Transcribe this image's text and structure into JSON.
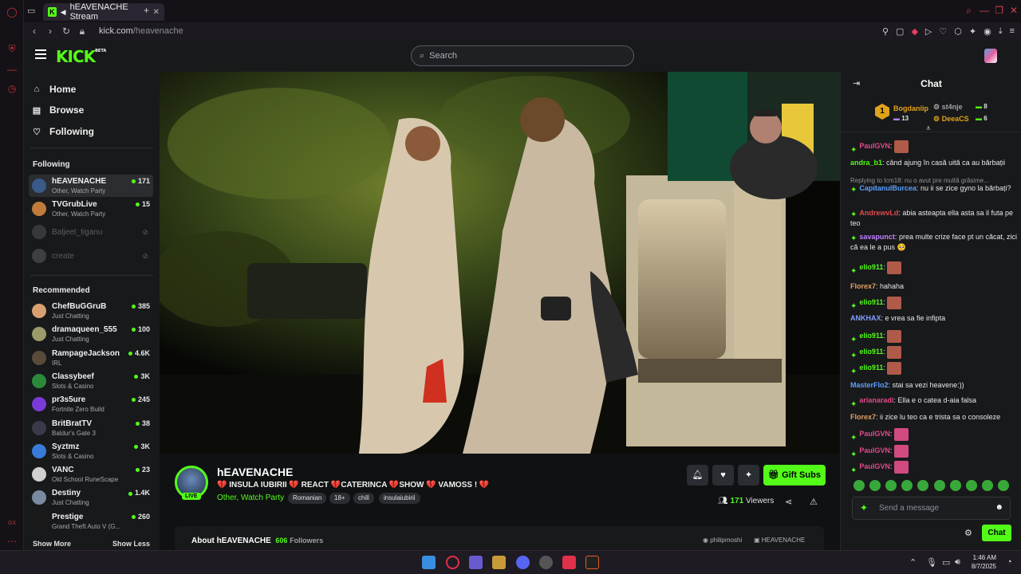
{
  "browser": {
    "tab_title": "hEAVENACHE Stream",
    "url_host": "kick.com",
    "url_path": "/heavenache"
  },
  "header": {
    "logo_text": "KICK",
    "logo_badge": "BETA",
    "search_placeholder": "Search"
  },
  "sidebar": {
    "nav": [
      {
        "label": "Home",
        "icon": "home-icon"
      },
      {
        "label": "Browse",
        "icon": "browse-icon"
      },
      {
        "label": "Following",
        "icon": "heart-icon"
      }
    ],
    "following_title": "Following",
    "following": [
      {
        "name": "hEAVENACHE",
        "category": "Other, Watch Party",
        "viewers": "171",
        "live": true,
        "color": "#3a5a8a"
      },
      {
        "name": "TVGrubLive",
        "category": "Other, Watch Party",
        "viewers": "15",
        "live": true,
        "color": "#c07a3a"
      },
      {
        "name": "Baljeet_tiganu",
        "category": "",
        "viewers": "",
        "live": false,
        "color": "#666666"
      },
      {
        "name": "create",
        "category": "",
        "viewers": "",
        "live": false,
        "color": "#777777"
      }
    ],
    "recommended_title": "Recommended",
    "recommended": [
      {
        "name": "ChefBuGGruB",
        "category": "Just Chatting",
        "viewers": "385",
        "color": "#d8a070"
      },
      {
        "name": "dramaqueen_555",
        "category": "Just Chatting",
        "viewers": "100",
        "color": "#9a9a6a"
      },
      {
        "name": "RampageJackson",
        "category": "IRL",
        "viewers": "4.6K",
        "color": "#5a4a3a"
      },
      {
        "name": "Classybeef",
        "category": "Slots & Casino",
        "viewers": "3K",
        "color": "#2a8a3a"
      },
      {
        "name": "pr3s5ure",
        "category": "Fortnite Zero Build",
        "viewers": "245",
        "color": "#7a3ad8"
      },
      {
        "name": "BritBratTV",
        "category": "Baldur's Gate 3",
        "viewers": "38",
        "color": "#3a3a4a"
      },
      {
        "name": "Syztmz",
        "category": "Slots & Casino",
        "viewers": "3K",
        "color": "#3a7ad8"
      },
      {
        "name": "VANC",
        "category": "Old School RuneScape",
        "viewers": "23",
        "color": "#d0d0d0"
      },
      {
        "name": "Destiny",
        "category": "Just Chatting",
        "viewers": "1.4K",
        "color": "#7a8aa0"
      },
      {
        "name": "Prestige",
        "category": "Grand Theft Auto V (G...",
        "viewers": "260",
        "color": "#1a1a1a"
      }
    ],
    "show_more": "Show More",
    "show_less": "Show Less"
  },
  "stream": {
    "streamer": "hEAVENACHE",
    "live_label": "LIVE",
    "title": "💔 INSULA IUBIRII 💔 REACT 💔CATERINCA 💔SHOW 💔 VAMOSS ! 💔",
    "category": "Other, Watch Party",
    "tags": [
      "Romanian",
      "18+",
      "chill",
      "insulaiubirii"
    ],
    "gift_label": "Gift Subs",
    "viewers_count": "171",
    "viewers_label": "Viewers",
    "about_title": "About hEAVENACHE",
    "followers": "606",
    "followers_label": "Followers",
    "social_1": "philipmoshi",
    "social_2": "HEAVENACHE"
  },
  "chat": {
    "title": "Chat",
    "top_gifters": [
      {
        "name": "Bogdaniip",
        "count": "13",
        "color": "#e0a21a"
      },
      {
        "name": "st4nje",
        "count": "8",
        "color": "#a0a0a0"
      },
      {
        "name": "DeeaCS",
        "count": "6",
        "color": "#e0a21a"
      }
    ],
    "top_rank": "1",
    "messages": [
      {
        "user": "PaulGVN",
        "color": "#e04a8a",
        "text": "",
        "emote": "brown"
      },
      {
        "user": "andra_b1",
        "color": "#53fc18",
        "text": "când ajung în casă uită ca au bărbații"
      },
      {
        "reply": "Replying to lcm18: nu o avut pre multă grăsime..."
      },
      {
        "user": "CapitanulBurcea",
        "color": "#5aa0ff",
        "text": "nu ii se zice gyno la bărbați?"
      },
      {
        "user": "AndrewvLd",
        "color": "#e04a4a",
        "text": "abia asteapta ella asta sa il futa pe teo"
      },
      {
        "user": "savapunct",
        "color": "#c080ff",
        "text": "prea multe crize face pt un căcat, zici că ea le a pus 🥺"
      },
      {
        "user": "elio911",
        "color": "#53fc18",
        "text": "",
        "emote": "brown"
      },
      {
        "user": "Florex7",
        "color": "#e0a060",
        "text": "hahaha"
      },
      {
        "user": "elio911",
        "color": "#53fc18",
        "text": "",
        "emote": "brown"
      },
      {
        "user": "ANKHAX",
        "color": "#80a0ff",
        "text": "e vrea sa fie infipta"
      },
      {
        "user": "elio911",
        "color": "#53fc18",
        "text": "",
        "emote": "brown"
      },
      {
        "user": "elio911",
        "color": "#53fc18",
        "text": "",
        "emote": "brown"
      },
      {
        "user": "elio911",
        "color": "#53fc18",
        "text": "",
        "emote": "brown"
      },
      {
        "user": "MasterFlo2",
        "color": "#5aa0ff",
        "text": "stai sa vezi heavene:))"
      },
      {
        "user": "arianaradi",
        "color": "#e04a8a",
        "text": "Ella e o catea d-aia falsa"
      },
      {
        "user": "Florex7",
        "color": "#e0a060",
        "text": "ii zice lu teo ca e trista sa o consoleze"
      },
      {
        "user": "PaulGVN",
        "color": "#e04a8a",
        "text": "",
        "emote": "pink"
      },
      {
        "user": "PaulGVN",
        "color": "#e04a8a",
        "text": "",
        "emote": "pink"
      },
      {
        "user": "PaulGVN",
        "color": "#e04a8a",
        "text": "",
        "emote": "pink"
      }
    ],
    "input_placeholder": "Send a message",
    "send_label": "Chat"
  },
  "taskbar": {
    "time": "1:46 AM",
    "date": "8/7/2025"
  },
  "colors": {
    "accent": "#53fc18",
    "bg": "#0f1112",
    "panel": "#18191b"
  }
}
